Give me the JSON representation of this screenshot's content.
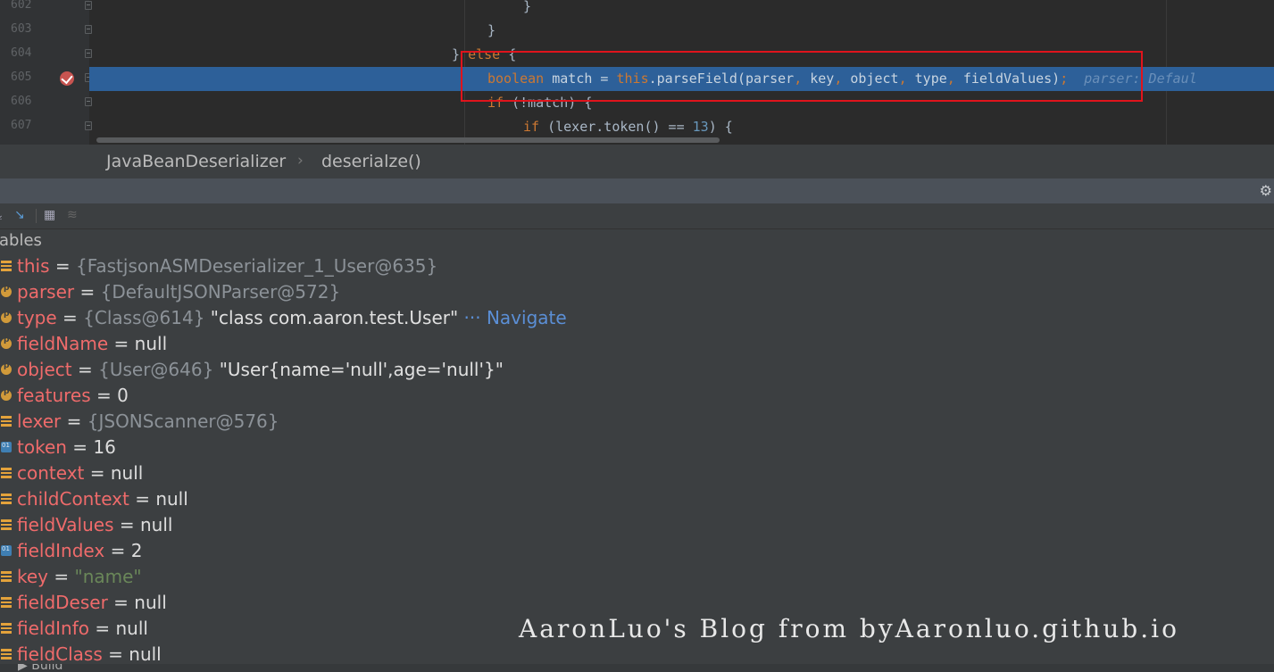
{
  "editor": {
    "lines": [
      {
        "num": "602",
        "indent": 586,
        "tokens": [
          {
            "t": "}",
            "c": ""
          }
        ]
      },
      {
        "num": "603",
        "indent": 546,
        "tokens": [
          {
            "t": "}",
            "c": ""
          }
        ]
      },
      {
        "num": "604",
        "indent": 506,
        "tokens": [
          {
            "t": "} ",
            "c": ""
          },
          {
            "t": "else",
            "c": "kw"
          },
          {
            "t": " {",
            "c": ""
          }
        ]
      },
      {
        "num": "605",
        "indent": 546,
        "current": true,
        "breakpoint": true,
        "tokens": [
          {
            "t": "boolean",
            "c": "kw"
          },
          {
            "t": " match = ",
            "c": ""
          },
          {
            "t": "this",
            "c": "kw"
          },
          {
            "t": ".parseField(parser",
            "c": ""
          },
          {
            "t": ",",
            "c": "kw"
          },
          {
            "t": " key",
            "c": ""
          },
          {
            "t": ",",
            "c": "kw"
          },
          {
            "t": " object",
            "c": ""
          },
          {
            "t": ",",
            "c": "kw"
          },
          {
            "t": " type",
            "c": ""
          },
          {
            "t": ",",
            "c": "kw"
          },
          {
            "t": " fieldValues)",
            "c": ""
          },
          {
            "t": ";",
            "c": "kw"
          },
          {
            "t": "  parser: Defaul",
            "c": "hint"
          }
        ]
      },
      {
        "num": "606",
        "indent": 546,
        "tokens": [
          {
            "t": "if",
            "c": "kw"
          },
          {
            "t": " (!match) {",
            "c": ""
          }
        ]
      },
      {
        "num": "607",
        "indent": 586,
        "tokens": [
          {
            "t": "if",
            "c": "kw"
          },
          {
            "t": " (lexer.token() == ",
            "c": ""
          },
          {
            "t": "13",
            "c": "num"
          },
          {
            "t": ") {",
            "c": ""
          }
        ]
      }
    ]
  },
  "breadcrumb": {
    "class_name": "JavaBeanDeserializer",
    "separator": "›",
    "method_name": "deserialze()"
  },
  "debug": {
    "section_title": "iables",
    "variables": [
      {
        "icon": "field",
        "name": "this",
        "eq": " = ",
        "ref": "{FastjsonASMDeserializer_1_User@635}"
      },
      {
        "icon": "param",
        "name": "parser",
        "eq": " = ",
        "ref": "{DefaultJSONParser@572}"
      },
      {
        "icon": "param",
        "name": "type",
        "eq": " = ",
        "ref": "{Class@614}",
        "str": " \"class com.aaron.test.User\"",
        "link": " ··· Navigate"
      },
      {
        "icon": "param",
        "name": "fieldName",
        "eq": " = ",
        "val": "null"
      },
      {
        "icon": "param",
        "name": "object",
        "eq": " = ",
        "ref": "{User@646}",
        "str": " \"User{name='null',age='null'}\""
      },
      {
        "icon": "param",
        "name": "features",
        "eq": " = ",
        "val": "0"
      },
      {
        "icon": "field",
        "name": "lexer",
        "eq": " = ",
        "ref": "{JSONScanner@576}"
      },
      {
        "icon": "prim",
        "name": "token",
        "eq": " = ",
        "val": "16"
      },
      {
        "icon": "field",
        "name": "context",
        "eq": " = ",
        "val": "null"
      },
      {
        "icon": "field",
        "name": "childContext",
        "eq": " = ",
        "val": "null"
      },
      {
        "icon": "field",
        "name": "fieldValues",
        "eq": " = ",
        "val": "null"
      },
      {
        "icon": "prim",
        "name": "fieldIndex",
        "eq": " = ",
        "val": "2"
      },
      {
        "icon": "field",
        "name": "key",
        "eq": " = ",
        "strv": "\"name\""
      },
      {
        "icon": "field",
        "name": "fieldDeser",
        "eq": " = ",
        "val": "null"
      },
      {
        "icon": "field",
        "name": "fieldInfo",
        "eq": " = ",
        "val": "null"
      },
      {
        "icon": "field",
        "name": "fieldClass",
        "eq": " = ",
        "val": "null"
      }
    ]
  },
  "watermark": "AaronLuo's Blog from byAaronluo.github.io"
}
